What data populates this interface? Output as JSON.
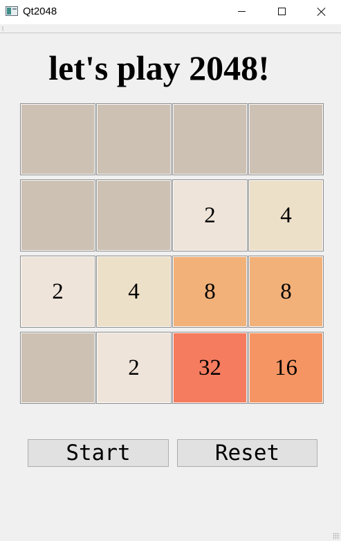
{
  "window": {
    "title": "Qt2048",
    "icon": "qt-app-icon"
  },
  "game": {
    "title": "let's play 2048!",
    "board": [
      [
        null,
        null,
        null,
        null
      ],
      [
        null,
        null,
        2,
        4
      ],
      [
        2,
        4,
        8,
        8
      ],
      [
        null,
        2,
        32,
        16
      ]
    ],
    "tile_colors": {
      "empty": "#cdc1b4",
      "2": "#eee4da",
      "4": "#ede0c8",
      "8": "#f2b179",
      "16": "#f59563",
      "32": "#f67c5f"
    }
  },
  "buttons": {
    "start_label": "Start",
    "reset_label": "Reset"
  }
}
